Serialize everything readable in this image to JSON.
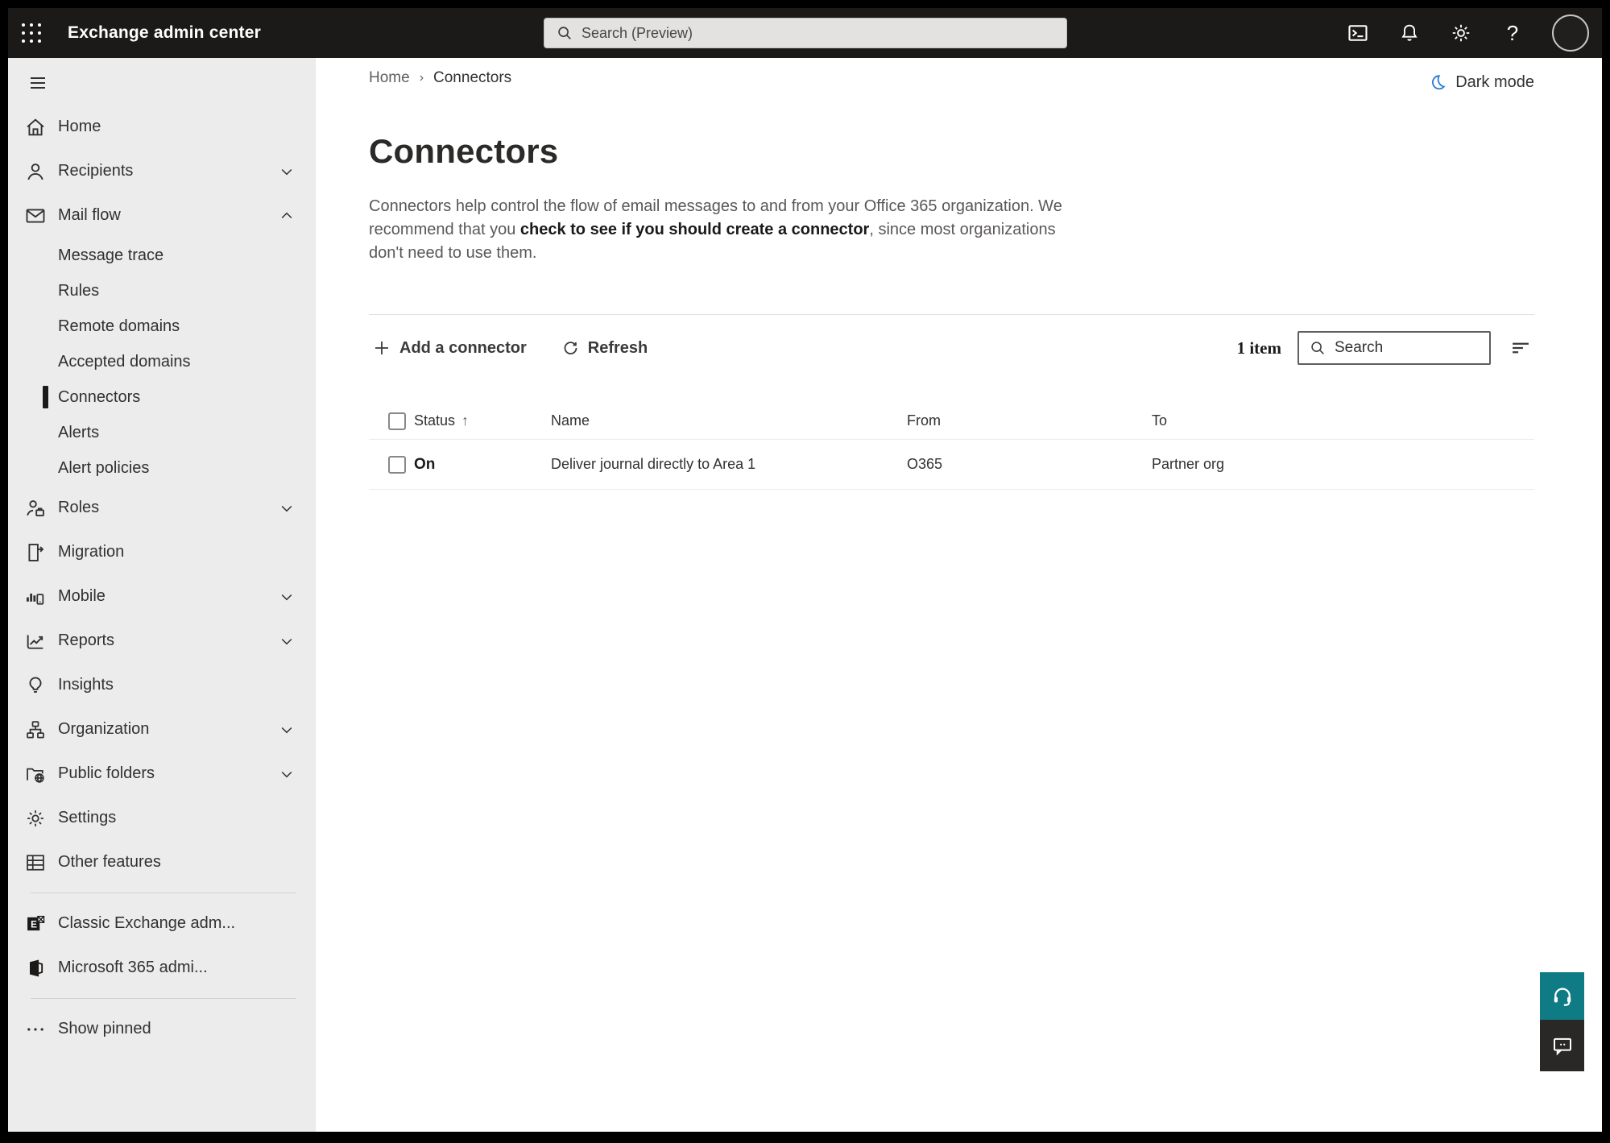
{
  "topbar": {
    "title": "Exchange admin center",
    "search_placeholder": "Search (Preview)"
  },
  "sidebar": {
    "items": [
      {
        "label": "Home"
      },
      {
        "label": "Recipients"
      },
      {
        "label": "Mail flow"
      },
      {
        "label": "Message trace"
      },
      {
        "label": "Rules"
      },
      {
        "label": "Remote domains"
      },
      {
        "label": "Accepted domains"
      },
      {
        "label": "Connectors"
      },
      {
        "label": "Alerts"
      },
      {
        "label": "Alert policies"
      },
      {
        "label": "Roles"
      },
      {
        "label": "Migration"
      },
      {
        "label": "Mobile"
      },
      {
        "label": "Reports"
      },
      {
        "label": "Insights"
      },
      {
        "label": "Organization"
      },
      {
        "label": "Public folders"
      },
      {
        "label": "Settings"
      },
      {
        "label": "Other features"
      },
      {
        "label": "Classic Exchange adm..."
      },
      {
        "label": "Microsoft 365 admi..."
      },
      {
        "label": "Show pinned"
      }
    ]
  },
  "breadcrumb": {
    "home": "Home",
    "current": "Connectors"
  },
  "dark_mode_label": "Dark mode",
  "page": {
    "title": "Connectors",
    "description_part1": "Connectors help control the flow of email messages to and from your Office 365 organization. We recommend that you ",
    "description_link": "check to see if you should create a connector",
    "description_part2": ", since most organizations don't need to use them."
  },
  "toolbar": {
    "add_label": "Add a connector",
    "refresh_label": "Refresh",
    "count": "1 item",
    "search_placeholder": "Search"
  },
  "table": {
    "headers": {
      "status": "Status",
      "name": "Name",
      "from": "From",
      "to": "To"
    },
    "sort_arrow": "↑",
    "rows": [
      {
        "status": "On",
        "name": "Deliver journal directly to Area 1",
        "from": "O365",
        "to": "Partner org"
      }
    ]
  },
  "colors": {
    "accent_blue": "#2b7cd3",
    "teal_help": "#0f7b85",
    "topbar_bg": "#1b1a19",
    "sidebar_bg": "#ececec"
  }
}
